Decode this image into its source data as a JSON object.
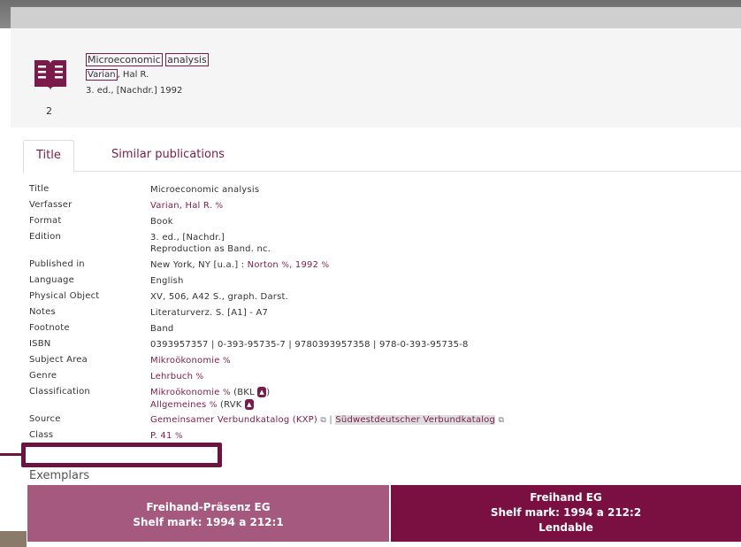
{
  "record": {
    "title_part1": "Microeconomic",
    "title_part2": "analysis",
    "author_surname": "Varian",
    "author_rest": ", Hal R.",
    "edition_line": "3. ed., [Nachdr.] 1992",
    "number": "2",
    "icon": "book-icon"
  },
  "tabs": [
    {
      "label": "Title",
      "active": true
    },
    {
      "label": "Similar publications",
      "active": false
    }
  ],
  "details": {
    "title": {
      "label": "Title",
      "value": "Microeconomic analysis"
    },
    "verfasser": {
      "label": "Verfasser",
      "value": "Varian, Hal R."
    },
    "format": {
      "label": "Format",
      "value": "Book"
    },
    "edition": {
      "label": "Edition",
      "value1": "3. ed., [Nachdr.]",
      "value2": "Reproduction as Band. nc."
    },
    "published": {
      "label": "Published in",
      "place": "New York, NY [u.a.] : ",
      "publisher": "Norton",
      "year": ", 1992"
    },
    "language": {
      "label": "Language",
      "value": "English"
    },
    "physical": {
      "label": "Physical Object",
      "value": "XV, 506, A42 S., graph. Darst."
    },
    "notes": {
      "label": "Notes",
      "value": "Literaturverz. S. [A1] - A7"
    },
    "footnote": {
      "label": "Footnote",
      "value": "Band"
    },
    "isbn": {
      "label": "ISBN",
      "value": "0393957357 | 0-393-95735-7 | 9780393957358 | 978-0-393-95735-8"
    },
    "subject": {
      "label": "Subject Area",
      "value": "Mikroökonomie"
    },
    "genre": {
      "label": "Genre",
      "value": "Lehrbuch"
    },
    "classification": {
      "label": "Classification",
      "item1": "Mikroökonomie",
      "item1_scheme": " (BKL ",
      "item2": "Allgemeines",
      "item2_scheme": " (RVK "
    },
    "source": {
      "label": "Source",
      "item1": "Gemeinsamer Verbundkatalog (KXP)",
      "separator": " | ",
      "item2": "Südwestdeutscher Verbundkatalog"
    },
    "class": {
      "label": "Class",
      "value": "P. 41"
    }
  },
  "exemplars": {
    "heading": "Exemplars",
    "items": [
      {
        "location": "Freihand-Präsenz EG",
        "shelf": "Shelf mark: 1994 a 212:1",
        "status": ""
      },
      {
        "location": "Freihand EG",
        "shelf": "Shelf mark: 1994 a 212:2",
        "status": "Lendable"
      }
    ]
  },
  "colors": {
    "accent": "#7a1c4b",
    "exemplar_1": "#a6597e",
    "exemplar_2": "#7a0f42",
    "highlight": "#6b1440"
  }
}
